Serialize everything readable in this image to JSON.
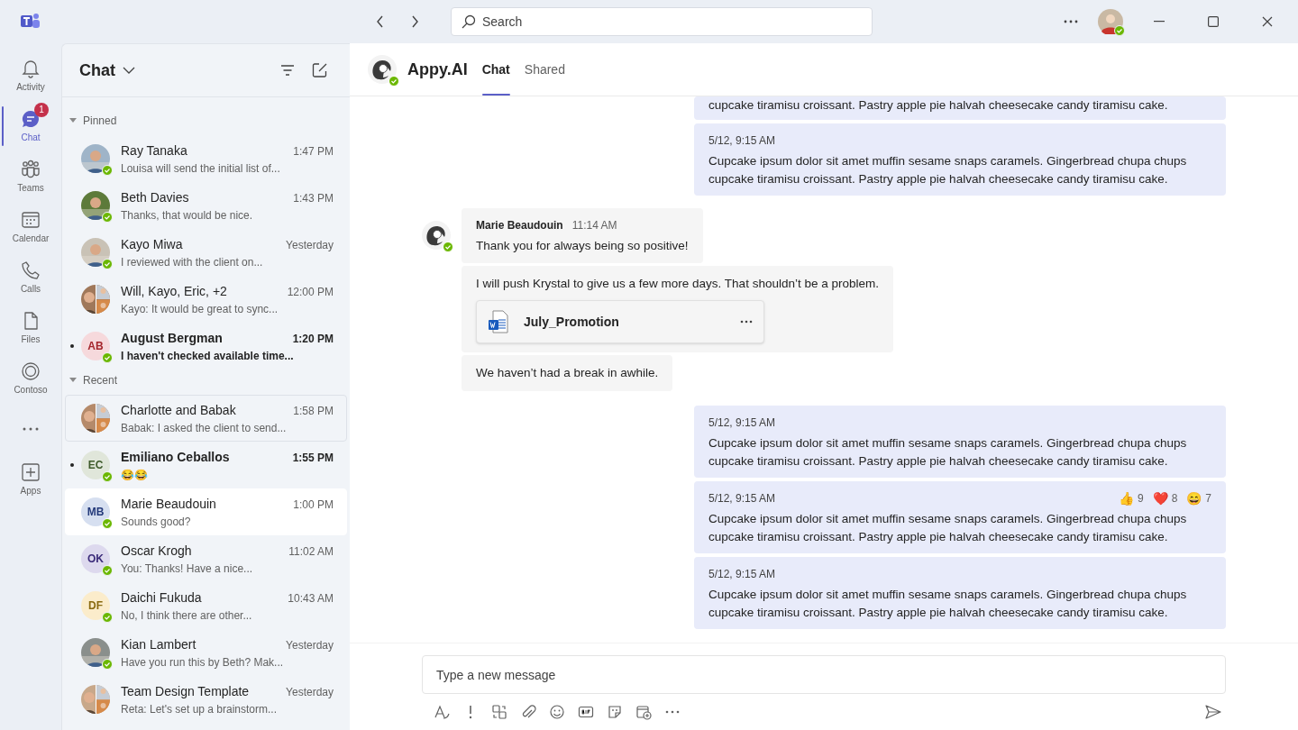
{
  "titlebar": {
    "search": {
      "placeholder": "Search"
    }
  },
  "rail": [
    {
      "label": "Activity",
      "selected": false
    },
    {
      "label": "Chat",
      "selected": true,
      "badge": "1"
    },
    {
      "label": "Teams",
      "selected": false
    },
    {
      "label": "Calendar",
      "selected": false
    },
    {
      "label": "Calls",
      "selected": false
    },
    {
      "label": "Files",
      "selected": false
    },
    {
      "label": "Contoso",
      "selected": false
    },
    {
      "selected": false
    },
    {
      "label": "Apps",
      "selected": false
    }
  ],
  "chat_list": {
    "title": "Chat",
    "sections": [
      {
        "label": "Pinned",
        "expanded": true,
        "items": [
          {
            "name": "Ray Tanaka",
            "preview": "Louisa will send the initial list of...",
            "time": "1:47 PM",
            "unread": false,
            "selected": false,
            "highlighted": false
          },
          {
            "name": "Beth Davies",
            "preview": "Thanks, that would be nice.",
            "time": "1:43 PM",
            "unread": false,
            "selected": false,
            "highlighted": false
          },
          {
            "name": "Kayo Miwa",
            "preview": "I reviewed with the client on...",
            "time": "Yesterday",
            "unread": false,
            "selected": false,
            "highlighted": false
          },
          {
            "name": "Will, Kayo, Eric, +2",
            "preview": "Kayo: It would be great to sync...",
            "time": "12:00 PM",
            "avatar": {
              "kind": "group",
              "color": "#a0785a"
            },
            "unread": false,
            "selected": false,
            "highlighted": false
          },
          {
            "name": "August Bergman",
            "preview": "I haven't checked available time...",
            "time": "1:20 PM",
            "avatar": {
              "kind": "initials",
              "initials": "AB",
              "color": "#f6d9dc"
            },
            "unread": true,
            "selected": false,
            "highlighted": false
          }
        ]
      },
      {
        "label": "Recent",
        "expanded": true,
        "items": [
          {
            "name": "Charlotte and Babak",
            "preview": "Babak: I asked the client to send...",
            "time": "1:58 PM",
            "avatar": {
              "kind": "group",
              "color": "#b58a6a"
            },
            "unread": false,
            "selected": false,
            "highlighted": true
          },
          {
            "name": "Emiliano Ceballos",
            "preview": "😂😂",
            "time": "1:55 PM",
            "avatar": {
              "kind": "initials",
              "initials": "EC",
              "color": "#e0e6da"
            },
            "unread": true,
            "selected": false,
            "highlighted": false
          },
          {
            "name": "Marie Beaudouin",
            "preview": "Sounds good?",
            "time": "1:00 PM",
            "avatar": {
              "kind": "initials",
              "initials": "MB",
              "color": "#d6dff0"
            },
            "unread": false,
            "selected": true,
            "highlighted": false
          },
          {
            "name": "Oscar Krogh",
            "preview": "You: Thanks! Have a nice...",
            "time": "11:02 AM",
            "avatar": {
              "kind": "initials",
              "initials": "OK",
              "color": "#ddd9ee"
            },
            "unread": false,
            "selected": false,
            "highlighted": false
          },
          {
            "name": "Daichi Fukuda",
            "preview": "No, I think there are other...",
            "time": "10:43 AM",
            "avatar": {
              "kind": "initials",
              "initials": "DF",
              "color": "#fbeccb"
            },
            "unread": false,
            "selected": false,
            "highlighted": false
          },
          {
            "name": "Kian Lambert",
            "preview": "Have you run this by Beth? Mak...",
            "time": "Yesterday",
            "unread": false,
            "selected": false,
            "highlighted": false
          },
          {
            "name": "Team Design Template",
            "preview": "Reta: Let's set up a brainstorm...",
            "time": "Yesterday",
            "avatar": {
              "kind": "group",
              "color": "#c8a88a"
            },
            "unread": false,
            "selected": false,
            "highlighted": false
          }
        ]
      }
    ]
  },
  "conversation": {
    "name": "Appy.AI",
    "tabs": [
      {
        "label": "Chat",
        "selected": true
      },
      {
        "label": "Shared",
        "selected": false
      }
    ],
    "messages": [
      {
        "kind": "own",
        "text": "cupcake tiramisu croissant. Pastry apple pie halvah cheesecake candy tiramisu cake."
      },
      {
        "kind": "own",
        "time": "5/12, 9:15 AM",
        "text": "Cupcake ipsum dolor sit amet muffin sesame snaps caramels. Gingerbread chupa chups cupcake tiramisu croissant. Pastry apple pie halvah cheesecake candy tiramisu cake."
      },
      {
        "kind": "incoming",
        "sender": "Marie Beaudouin",
        "time": "11:14 AM",
        "parts": [
          {
            "text": "Thank you for always being so positive!"
          },
          {
            "text": "I will push Krystal to give us a few more days. That shouldn’t be a problem.",
            "file": "July_Promotion"
          },
          {
            "text": "We haven’t had a break in awhile."
          }
        ]
      },
      {
        "kind": "own",
        "time": "5/12, 9:15 AM",
        "text": "Cupcake ipsum dolor sit amet muffin sesame snaps caramels. Gingerbread chupa chups cupcake tiramisu croissant. Pastry apple pie halvah cheesecake candy tiramisu cake."
      },
      {
        "kind": "own",
        "time": "5/12, 9:15 AM",
        "text": "Cupcake ipsum dolor sit amet muffin sesame snaps caramels. Gingerbread chupa chups cupcake tiramisu croissant. Pastry apple pie halvah cheesecake candy tiramisu cake.",
        "reactions": [
          {
            "emoji": "👍",
            "count": "9"
          },
          {
            "emoji": "❤️",
            "count": "8"
          },
          {
            "emoji": "😄",
            "count": "7"
          }
        ]
      },
      {
        "kind": "own",
        "time": "5/12, 9:15 AM",
        "text": "Cupcake ipsum dolor sit amet muffin sesame snaps caramels. Gingerbread chupa chups cupcake tiramisu croissant. Pastry apple pie halvah cheesecake candy tiramisu cake."
      }
    ],
    "compose": {
      "placeholder": "Type a new message"
    }
  }
}
